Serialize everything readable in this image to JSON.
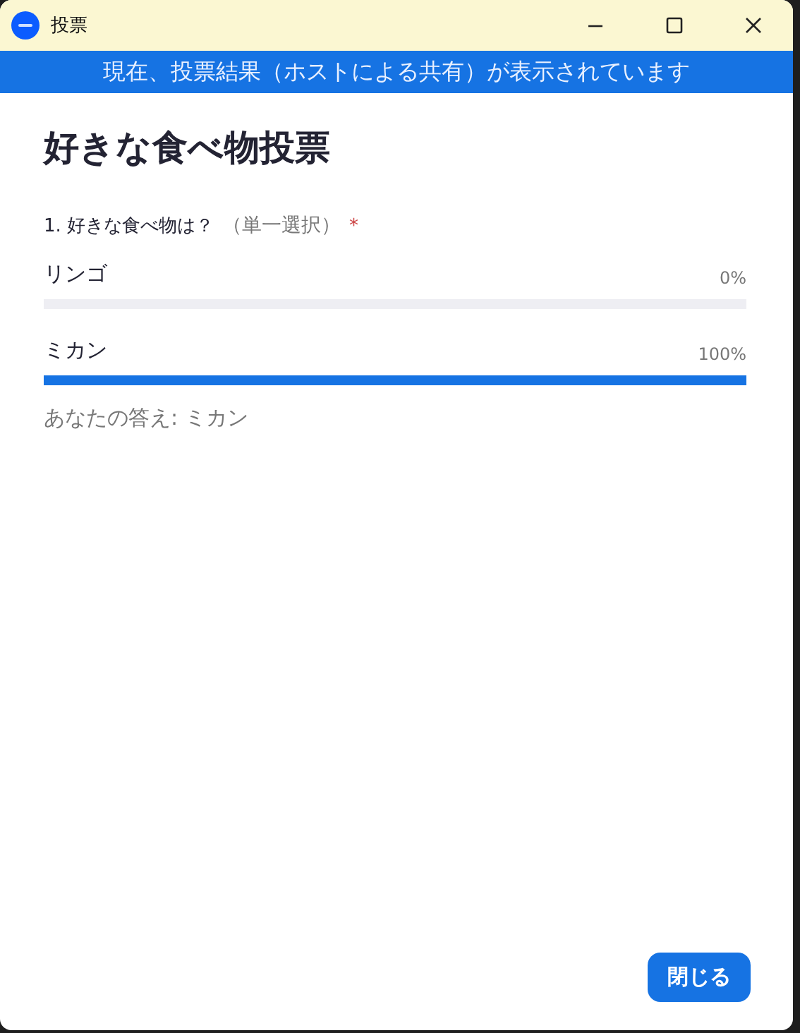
{
  "window": {
    "title": "投票"
  },
  "banner": "現在、投票結果（ホストによる共有）が表示されています",
  "poll": {
    "title": "好きな食べ物投票",
    "question": {
      "number": "1.",
      "text": "好きな食べ物は？",
      "type": "（単一選択）",
      "required_mark": "*"
    },
    "options": [
      {
        "label": "リンゴ",
        "percent": "0%"
      },
      {
        "label": "ミカン",
        "percent": "100%",
        "level": 1
      }
    ],
    "your_answer": "あなたの答え: ミカン"
  },
  "buttons": [
    "閉じる"
  ]
}
